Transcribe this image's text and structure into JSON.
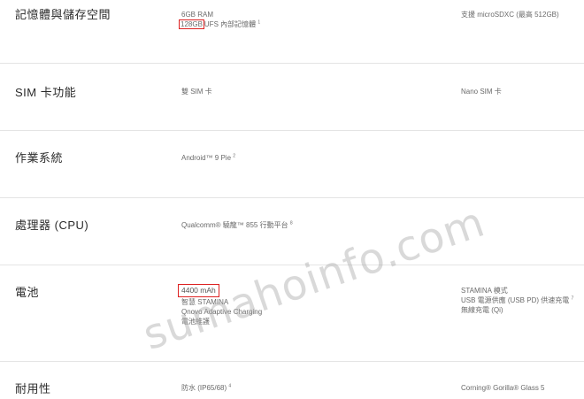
{
  "specs": [
    {
      "label": "記憶體與儲存空間",
      "mid_line1": "6GB RAM",
      "mid_line2_hl": "128GB",
      "mid_line2_rest": "UFS 內部記憶體",
      "mid_line2_sup": "1",
      "right_line1": "支援 microSDXC (最高 512GB)"
    },
    {
      "label": "SIM 卡功能",
      "mid_line1": "雙 SIM 卡",
      "right_line1": "Nano SIM 卡"
    },
    {
      "label": "作業系統",
      "mid_line1": "Android™ 9 Pie",
      "mid_sup": "2"
    },
    {
      "label": "處理器 (CPU)",
      "mid_line1": "Qualcomm® 驍龍™ 855 行動平台",
      "mid_sup": "8"
    },
    {
      "label": "電池",
      "mid_line1": "4400 mAh",
      "mid_line2": "智慧 STAMINA",
      "mid_line3": "Qnovo Adaptive Charging",
      "mid_line4": "電池維護",
      "right_line1": "STAMINA 模式",
      "right_line2": "USB 電源供應 (USB PD) 供速充電",
      "right_line2_sup": "7",
      "right_line3": "無線充電 (Qi)"
    },
    {
      "label": "耐用性",
      "mid_line1": "防水 (IP65/68)",
      "mid_sup": "4",
      "right_line1": "Corning® Gorilla® Glass 5"
    }
  ],
  "watermark": "sumahoinfo.com",
  "colors": {
    "highlight_border": "#dd2222",
    "separator": "#e4e4e4"
  }
}
